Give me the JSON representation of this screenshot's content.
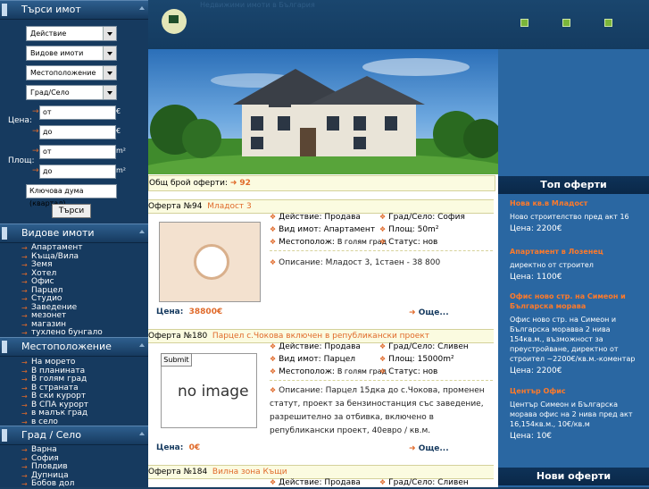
{
  "sidebar": {
    "search_title": "Търси имот",
    "selects": [
      "Действие",
      "Видове имоти",
      "Местоположение",
      "Град/Село"
    ],
    "price_label": "Цена:",
    "area_label": "Площ:",
    "from": "от",
    "to": "до",
    "price_unit": "€",
    "area_unit": "m²",
    "keyword_placeholder": "Ключова дума (квартал)",
    "search_button": "Търси",
    "types_title": "Видове имоти",
    "types": [
      "Апартамент",
      "Къща/Вила",
      "Земя",
      "Хотел",
      "Офис",
      "Парцел",
      "Студио",
      "Заведение",
      "мезонет",
      "магазин",
      "тухлено бунгало"
    ],
    "location_title": "Местоположение",
    "locations": [
      "На морето",
      "В планината",
      "В голям град",
      "В страната",
      "В ски курорт",
      "В СПА курорт",
      "в малък град",
      "в село"
    ],
    "city_title": "Град / Село",
    "cities": [
      "Варна",
      "София",
      "Пловдив",
      "Дупница",
      "Бобов дол"
    ]
  },
  "header": {
    "tagline": "Недвижими имоти в България",
    "nav": [
      "",
      "",
      ""
    ]
  },
  "main": {
    "count_label": "Общ брой оферти:",
    "count": "92",
    "offers": [
      {
        "title": "Оферта №94",
        "link": "Младост 3",
        "action_label": "Действие:",
        "action": "Продава",
        "type_label": "Вид имот:",
        "type": "Апартамент",
        "location_label": "Местополож:",
        "location": "В голям град",
        "city_label": "Град/Село:",
        "city": "София",
        "area_label": "Площ:",
        "area": "50m²",
        "status_label": "Статус:",
        "status": "нов",
        "desc_label": "Описание:",
        "desc": "Младост 3, 1стаен - 38 800",
        "price_label": "Цена:",
        "price": "38800€",
        "more": "Още..."
      },
      {
        "title": "Оферта №180",
        "link": "Парцел с.Чокова включен в републикански проект",
        "action_label": "Действие:",
        "action": "Продава",
        "type_label": "Вид имот:",
        "type": "Парцел",
        "location_label": "Местополож:",
        "location": "В голям град",
        "city_label": "Град/Село:",
        "city": "Сливен",
        "area_label": "Площ:",
        "area": "15000m²",
        "status_label": "Статус:",
        "status": "нов",
        "desc_label": "Описание:",
        "desc": "Парцел 15дка до с.Чокова, променен статут, проект за бензиностанция със заведение, разрешително за отбивка, включено в републикански проект, 40евро / кв.м.",
        "price_label": "Цена:",
        "price": "0€",
        "more": "Още...",
        "submit": "Submit",
        "noimage": "no image"
      },
      {
        "title": "Оферта №184",
        "link": "Вилна зона Къщи",
        "action_label": "Действие:",
        "action": "Продава",
        "city_label": "Град/Село:",
        "city": "Сливен"
      }
    ]
  },
  "right": {
    "top_title": "Топ оферти",
    "top_offers": [
      {
        "title": "Нова кв.в Младост",
        "text": "Ново строителство пред акт 16",
        "price_label": "Цена:",
        "price": "2200€"
      },
      {
        "title": "Апартамент в Лозенец",
        "text": "директно от строител",
        "price_label": "Цена:",
        "price": "1100€"
      },
      {
        "title": "Офис ново стр. на Симеон и Българска морава",
        "text": "Офис ново стр. на Симеон и Българска моравва 2 нива 154кв.м., възможност за преустройване, директно от строител ~2200€/кв.м.-коментар",
        "price_label": "Цена:",
        "price": "2200€"
      },
      {
        "title": "Център Офис",
        "text": "Център Симеон и Българска морава офис на 2 нива пред акт 16,154кв.м., 10€/кв.м",
        "price_label": "Цена:",
        "price": "10€"
      }
    ],
    "new_title": "Нови оферти"
  },
  "colors": {
    "accent": "#e06a2a",
    "sidebar": "#163a5f",
    "right": "#2a67a2"
  }
}
